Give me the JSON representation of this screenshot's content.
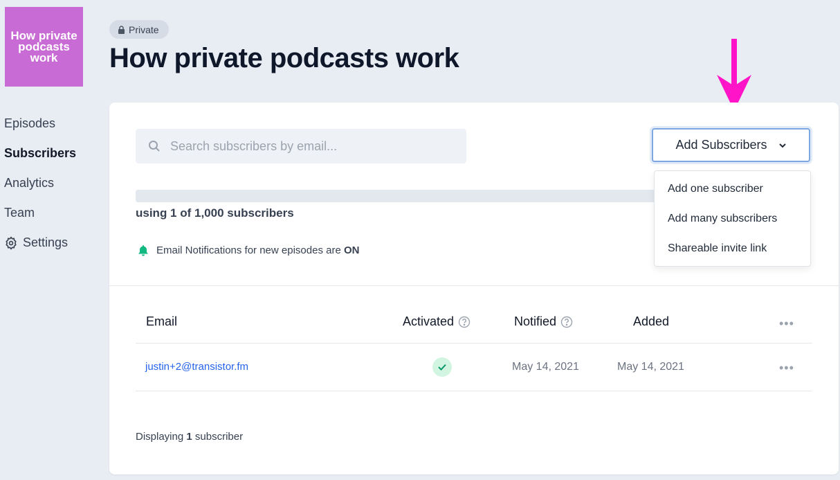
{
  "podcast": {
    "logo_text": "How private podcasts work",
    "badge": "Private",
    "title": "How private podcasts work"
  },
  "nav": {
    "items": [
      {
        "label": "Episodes"
      },
      {
        "label": "Subscribers"
      },
      {
        "label": "Analytics"
      },
      {
        "label": "Team"
      },
      {
        "label": "Settings"
      }
    ]
  },
  "search": {
    "placeholder": "Search subscribers by email..."
  },
  "add_button": {
    "label": "Add Subscribers",
    "menu": [
      "Add one subscriber",
      "Add many subscribers",
      "Shareable invite link"
    ]
  },
  "usage": {
    "text": "using 1 of 1,000 subscribers",
    "used": 1,
    "limit": 1000
  },
  "notifications": {
    "prefix": "Email Notifications for new episodes are ",
    "status": "ON"
  },
  "table": {
    "headers": {
      "email": "Email",
      "activated": "Activated",
      "notified": "Notified",
      "added": "Added"
    },
    "rows": [
      {
        "email": "justin+2@transistor.fm",
        "activated": true,
        "notified": "May 14, 2021",
        "added": "May 14, 2021"
      }
    ]
  },
  "footer": {
    "prefix": "Displaying ",
    "count": "1",
    "suffix": " subscriber"
  },
  "colors": {
    "accent": "#2563eb",
    "logo_bg": "#c86bd4",
    "arrow": "#ff14c8",
    "success": "#10b981"
  }
}
